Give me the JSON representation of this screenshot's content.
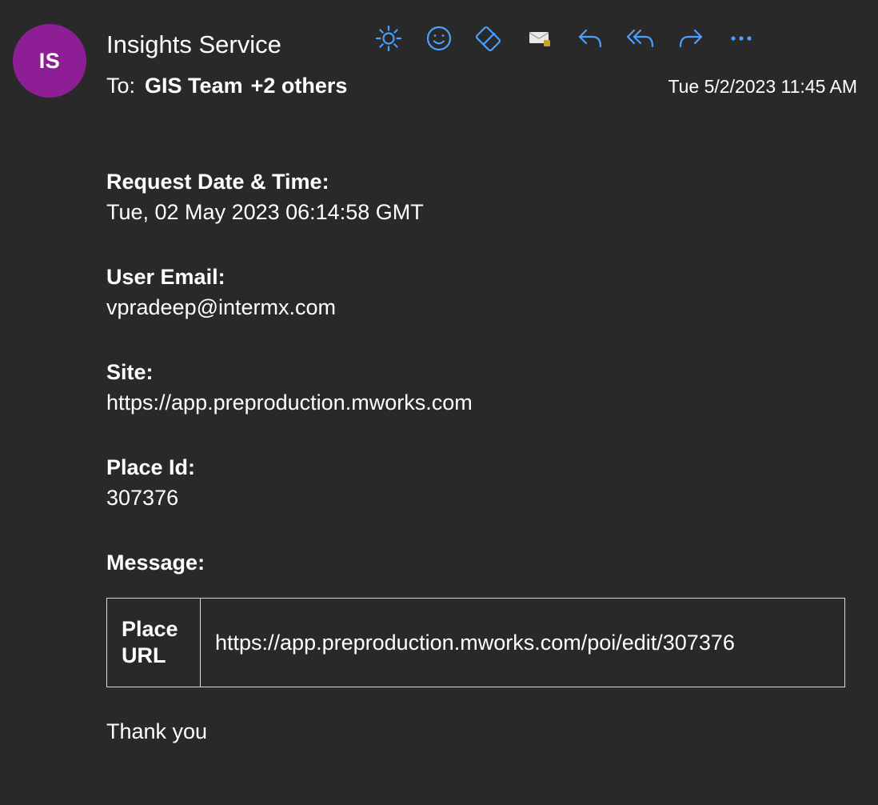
{
  "header": {
    "avatar_initials": "IS",
    "avatar_color": "#8e1e96",
    "sender_name": "Insights Service",
    "to_label": "To:",
    "to_recipient": "GIS Team",
    "to_others": "+2 others",
    "timestamp": "Tue 5/2/2023 11:45 AM",
    "accent_color": "#4a9fff"
  },
  "toolbar": {
    "buttons": [
      {
        "icon": "sun-icon",
        "action": "immersive-reader"
      },
      {
        "icon": "smiley-icon",
        "action": "react"
      },
      {
        "icon": "tag-icon",
        "action": "categorize"
      },
      {
        "icon": "envelope-icon",
        "action": "mark-unread"
      },
      {
        "icon": "reply-icon",
        "action": "reply"
      },
      {
        "icon": "reply-all-icon",
        "action": "reply-all"
      },
      {
        "icon": "forward-icon",
        "action": "forward"
      },
      {
        "icon": "more-icon",
        "action": "more-actions"
      }
    ]
  },
  "body": {
    "fields": [
      {
        "label": "Request Date & Time:",
        "value": "Tue, 02 May 2023 06:14:58 GMT"
      },
      {
        "label": "User Email:",
        "value": "vpradeep@intermx.com"
      },
      {
        "label": "Site:",
        "value": "https://app.preproduction.mworks.com"
      },
      {
        "label": "Place Id:",
        "value": "307376"
      }
    ],
    "message_label": "Message:",
    "message_table": {
      "key_line1": "Place",
      "key_line2": "URL",
      "value": "https://app.preproduction.mworks.com/poi/edit/307376"
    },
    "closing": "Thank you"
  }
}
